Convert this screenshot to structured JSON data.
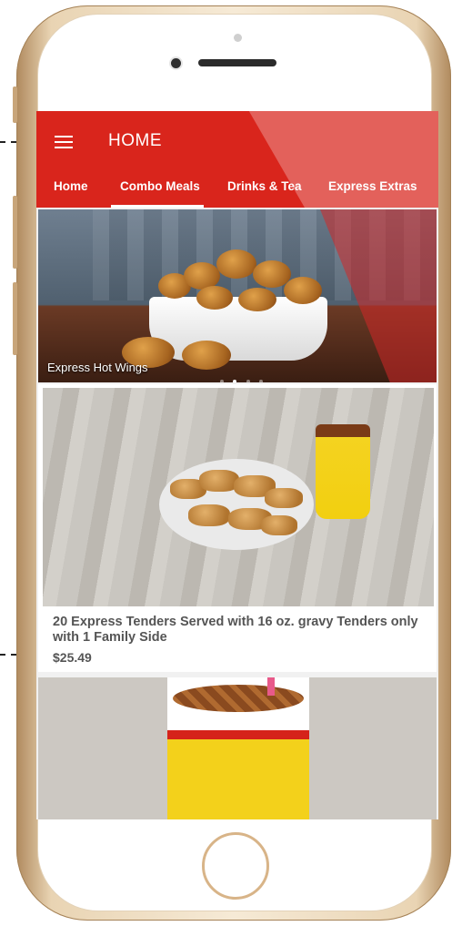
{
  "app": {
    "title": "HOME"
  },
  "tabs": [
    {
      "label": "Home"
    },
    {
      "label": "Combo Meals"
    },
    {
      "label": "Drinks & Tea"
    },
    {
      "label": "Express Extras"
    }
  ],
  "banner": {
    "caption": "Express Hot Wings",
    "slides_total": 4,
    "active_slide": 2
  },
  "items": [
    {
      "title": "20 Express Tenders Served with 16 oz. gravy Tenders only with 1 Family Side",
      "price": "$25.49"
    }
  ],
  "colors": {
    "accent": "#d9251c",
    "text_muted": "#555555"
  },
  "icons": {
    "menu": "hamburger-menu-icon"
  }
}
